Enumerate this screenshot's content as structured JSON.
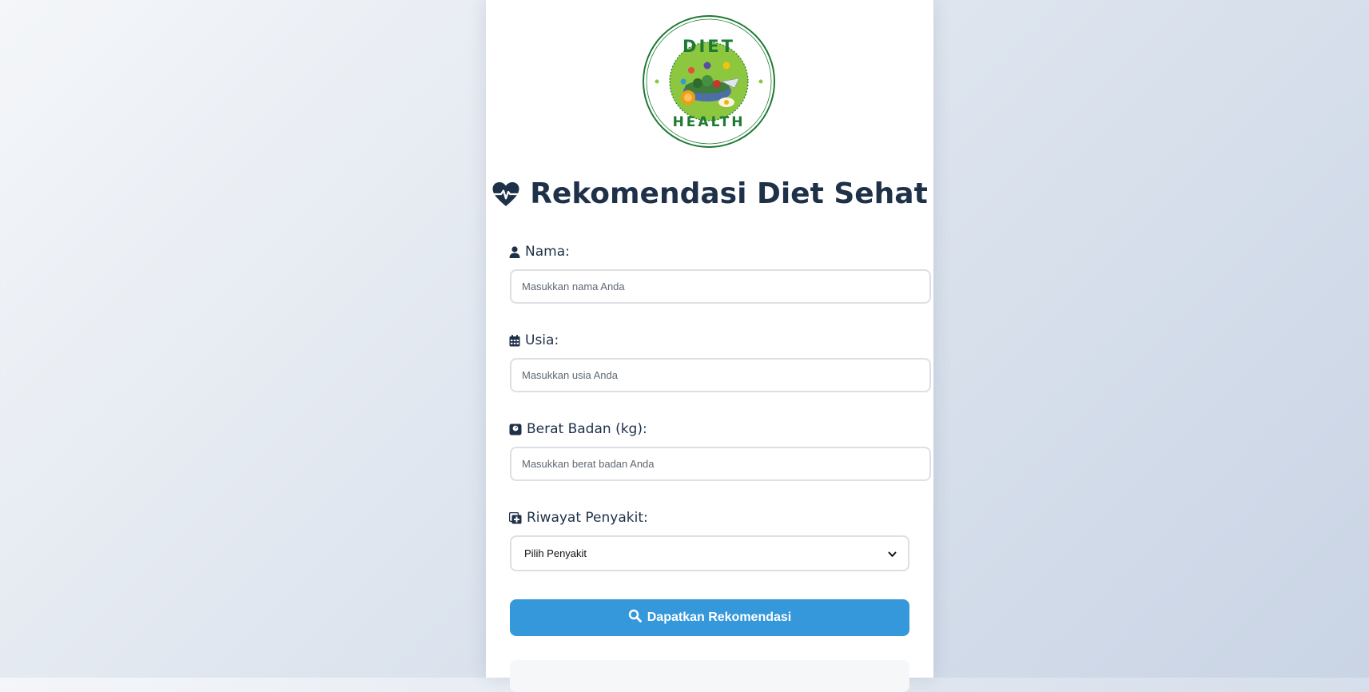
{
  "header": {
    "logo_text_top": "DIET",
    "logo_text_bottom": "HEALTH",
    "title": "Rekomendasi Diet Sehat",
    "title_icon": "heartbeat-icon"
  },
  "form": {
    "nama": {
      "label": "Nama:",
      "icon": "user-icon",
      "placeholder": "Masukkan nama Anda"
    },
    "usia": {
      "label": "Usia:",
      "icon": "calendar-icon",
      "placeholder": "Masukkan usia Anda"
    },
    "berat": {
      "label": "Berat Badan (kg):",
      "icon": "weight-scale-icon",
      "placeholder": "Masukkan berat badan Anda"
    },
    "penyakit": {
      "label": "Riwayat Penyakit:",
      "icon": "notes-medical-icon",
      "selected": "Pilih Penyakit"
    },
    "submit": {
      "label": "Dapatkan Rekomendasi",
      "icon": "search-icon"
    }
  },
  "colors": {
    "title": "#1e3149",
    "button": "#3498db",
    "logo_green": "#1e7a33",
    "logo_lime": "#8dc63f"
  }
}
